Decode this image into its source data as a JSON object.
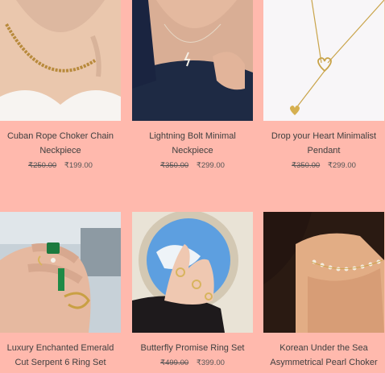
{
  "products": [
    {
      "name": "Cuban Rope Choker Chain Neckpiece",
      "old_price": "₹250.00",
      "price": "₹199.00",
      "image": "woman-wearing-gold-rope-chain"
    },
    {
      "name": "Lightning Bolt Minimal Neckpiece",
      "old_price": "₹350.00",
      "price": "₹299.00",
      "image": "woman-wearing-lightning-bolt-pendant"
    },
    {
      "name": "Drop your Heart Minimalist Pendant",
      "old_price": "₹350.00",
      "price": "₹299.00",
      "image": "gold-heart-drop-necklace-on-white"
    },
    {
      "name": "Luxury Enchanted Emerald Cut Serpent 6 Ring Set",
      "old_price": "",
      "price": "",
      "image": "hand-with-emerald-and-serpent-rings"
    },
    {
      "name": "Butterfly Promise Ring Set",
      "old_price": "₹499.00",
      "price": "₹399.00",
      "image": "hand-with-butterfly-rings-and-mirror"
    },
    {
      "name": "Korean Under the Sea Asymmetrical Pearl Choker",
      "old_price": "",
      "price": "",
      "image": "woman-wearing-pearl-choker"
    }
  ],
  "colors": {
    "background": "#ffb9ad"
  }
}
